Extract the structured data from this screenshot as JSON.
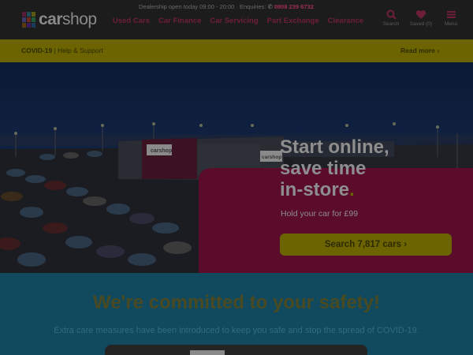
{
  "header": {
    "logo_text_bold": "car",
    "logo_text_light": "shop",
    "opening_text": "Dealership open today 09:00 - 20:00 · Enquiries:",
    "phone": "0808 239 6732",
    "nav": [
      {
        "label": "Used Cars"
      },
      {
        "label": "Car Finance"
      },
      {
        "label": "Car Servicing"
      },
      {
        "label": "Part Exchange"
      },
      {
        "label": "Clearance"
      }
    ],
    "icons": [
      {
        "icon": "search-icon",
        "label": "Search"
      },
      {
        "icon": "heart-icon",
        "label": "Saved (0)"
      },
      {
        "icon": "menu-icon",
        "label": "Menu"
      }
    ]
  },
  "covid_bar": {
    "title": "COVID-19",
    "link": "| Help & Support",
    "read_more": "Read more"
  },
  "hero": {
    "title_line1": "Start online,",
    "title_line2": "save time",
    "title_line3": "in-store",
    "title_dot": ".",
    "subtitle": "Hold your car for £99",
    "search_button": "Search 7,817 cars"
  },
  "building_signs": {
    "sign": "carshop"
  },
  "safety": {
    "heading": "We're committed to your safety!",
    "text": "Extra care measures have been introduced to keep you safe and stop the spread of COVID-19."
  },
  "colors": {
    "brand_pink": "#7a1036",
    "brand_yellow": "#6b6400",
    "safety_bg": "#11495e"
  }
}
